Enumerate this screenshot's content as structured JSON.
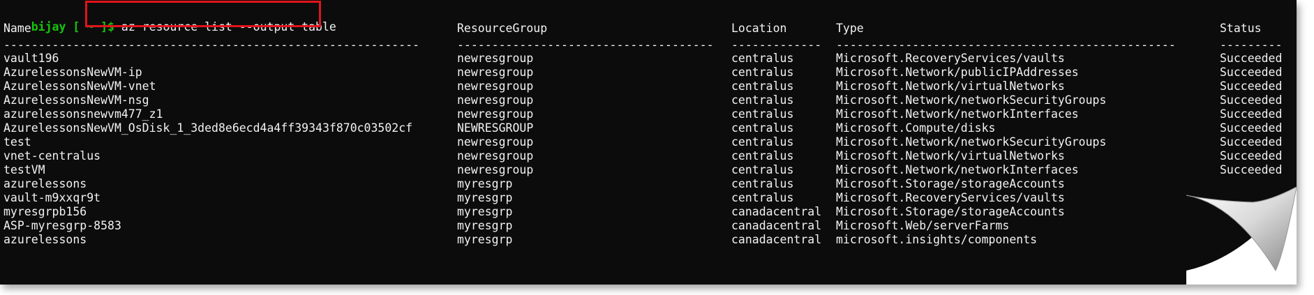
{
  "prompt": {
    "user": "bijay",
    "path": "[ ~ ]$",
    "command": "az resource list --output table"
  },
  "columns": [
    "Name",
    "ResourceGroup",
    "Location",
    "Type",
    "Status"
  ],
  "separators": [
    "------------------------------------------------------------",
    "-------------------------------------",
    "-------------",
    "-------------------------------------------------",
    "---------"
  ],
  "rows": [
    {
      "name": "vault196",
      "group": "newresgroup",
      "location": "centralus",
      "type": "Microsoft.RecoveryServices/vaults",
      "status": "Succeeded"
    },
    {
      "name": "AzurelessonsNewVM-ip",
      "group": "newresgroup",
      "location": "centralus",
      "type": "Microsoft.Network/publicIPAddresses",
      "status": "Succeeded"
    },
    {
      "name": "AzurelessonsNewVM-vnet",
      "group": "newresgroup",
      "location": "centralus",
      "type": "Microsoft.Network/virtualNetworks",
      "status": "Succeeded"
    },
    {
      "name": "AzurelessonsNewVM-nsg",
      "group": "newresgroup",
      "location": "centralus",
      "type": "Microsoft.Network/networkSecurityGroups",
      "status": "Succeeded"
    },
    {
      "name": "azurelessonsnewvm477_z1",
      "group": "newresgroup",
      "location": "centralus",
      "type": "Microsoft.Network/networkInterfaces",
      "status": "Succeeded"
    },
    {
      "name": "AzurelessonsNewVM_OsDisk_1_3ded8e6ecd4a4ff39343f870c03502cf",
      "group": "NEWRESGROUP",
      "location": "centralus",
      "type": "Microsoft.Compute/disks",
      "status": "Succeeded"
    },
    {
      "name": "test",
      "group": "newresgroup",
      "location": "centralus",
      "type": "Microsoft.Network/networkSecurityGroups",
      "status": "Succeeded"
    },
    {
      "name": "vnet-centralus",
      "group": "newresgroup",
      "location": "centralus",
      "type": "Microsoft.Network/virtualNetworks",
      "status": "Succeeded"
    },
    {
      "name": "testVM",
      "group": "newresgroup",
      "location": "centralus",
      "type": "Microsoft.Network/networkInterfaces",
      "status": "Succeeded"
    },
    {
      "name": "azurelessons",
      "group": "myresgrp",
      "location": "centralus",
      "type": "Microsoft.Storage/storageAccounts",
      "status": ""
    },
    {
      "name": "vault-m9xxqr9t",
      "group": "myresgrp",
      "location": "centralus",
      "type": "Microsoft.RecoveryServices/vaults",
      "status": ""
    },
    {
      "name": "myresgrpb156",
      "group": "myresgrp",
      "location": "canadacentral",
      "type": "Microsoft.Storage/storageAccounts",
      "status": ""
    },
    {
      "name": "ASP-myresgrp-8583",
      "group": "myresgrp",
      "location": "canadacentral",
      "type": "Microsoft.Web/serverFarms",
      "status": ""
    },
    {
      "name": "azurelessons",
      "group": "myresgrp",
      "location": "canadacentral",
      "type": "microsoft.insights/components",
      "status": ""
    }
  ]
}
